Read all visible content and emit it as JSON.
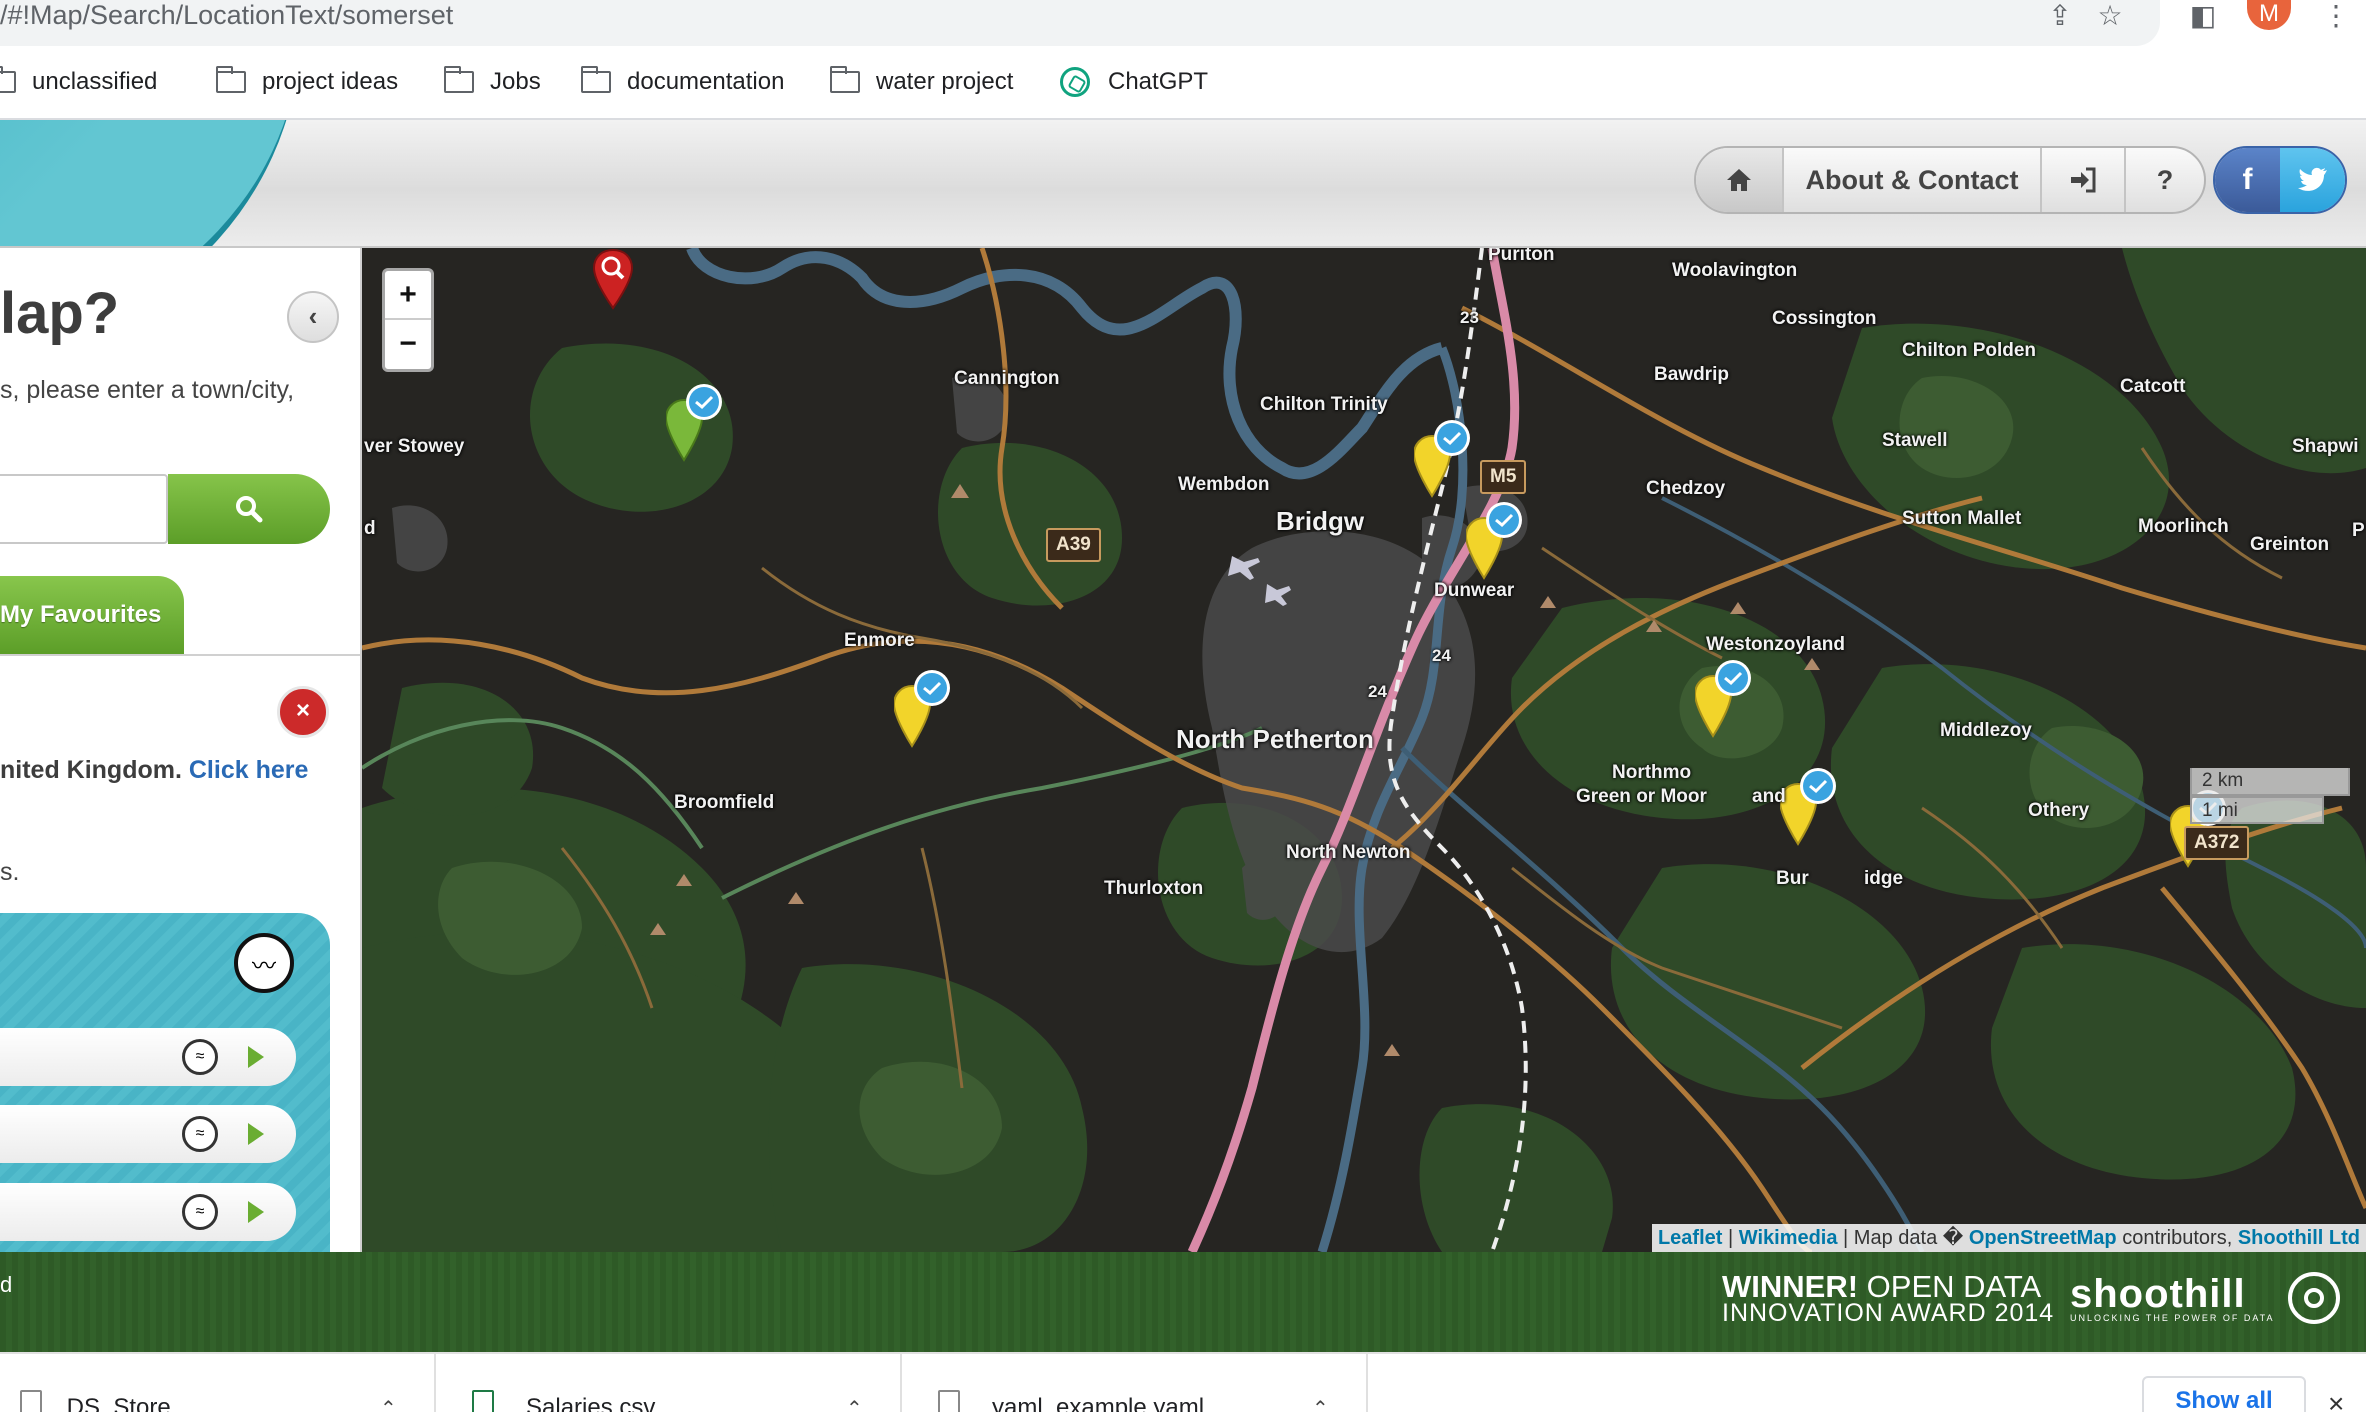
{
  "browser": {
    "url": "/#!Map/Search/LocationText/somerset",
    "profile_initial": "M",
    "bookmarks": [
      "unclassified",
      "project ideas",
      "Jobs",
      "documentation",
      "water project",
      "ChatGPT"
    ]
  },
  "header": {
    "nav_about": "About & Contact",
    "nav_help": "?",
    "social_facebook": "f"
  },
  "sidebar": {
    "title": "lap?",
    "prompt": "s, please enter a town/city,",
    "favourites_label": "My Favourites",
    "info_prefix": "nited Kingdom.",
    "info_link": "Click here",
    "info_tail": "s.",
    "close_symbol": "×"
  },
  "map": {
    "zoom_in": "+",
    "zoom_out": "−",
    "places": {
      "puriton": "Puriton",
      "woolavington": "Woolavington",
      "cossington": "Cossington",
      "chilton_polden": "Chilton Polden",
      "bawdrip": "Bawdrip",
      "catcott": "Catcott",
      "cannington": "Cannington",
      "chilton_trinity": "Chilton Trinity",
      "nether_stowey": "ver Stowey",
      "stawell": "Stawell",
      "shapwick": "Shapwi",
      "wembdon": "Wembdon",
      "chedzoy": "Chedzoy",
      "bridgwater": "Bridgw",
      "sutton_mallet": "Sutton Mallet",
      "moorlinch": "Moorlinch",
      "greinton": "Greinton",
      "dunwear": "Dunwear",
      "weston_zoyland": "Westonzoyland",
      "enmore": "Enmore",
      "middlezoy": "Middlezoy",
      "north_petherton": "North Petherton",
      "northmoor_1": "Northmo",
      "northmoor_2": "Green or Moor",
      "northmoor_3": "and",
      "othery": "Othery",
      "broomfield": "Broomfield",
      "north_newton": "North Newton",
      "thurloxton": "Thurloxton",
      "burrowbridge_1": "Bur",
      "burrowbridge_2": "idge",
      "left_d": "d",
      "right_p": "P"
    },
    "roads": {
      "a39": "A39",
      "m5": "M5",
      "a372": "A372",
      "j23": "23",
      "j24a": "24",
      "j24b": "24"
    },
    "scale_km": "2 km",
    "scale_mi": "1 mi",
    "attribution": {
      "leaflet": "Leaflet",
      "sep1": " | ",
      "wikimedia": "Wikimedia",
      "sep2": " | Map data � ",
      "osm": "OpenStreetMap",
      "contributors": " contributors, ",
      "shoothill": "Shoothill Ltd"
    },
    "colors": {
      "land_dark": "#262522",
      "field_green": "#2f4a28",
      "river": "#4a6b84",
      "road_orange": "#b07a3a",
      "motorway_pink": "#d98aa8"
    }
  },
  "footer": {
    "left_text": "d",
    "award_bold": "WINNER!",
    "award_rest": " OPEN DATA",
    "award_line2": "INNOVATION AWARD 2014",
    "logo_text": "shoothill",
    "logo_tag": "UNLOCKING THE POWER OF DATA"
  },
  "downloads": {
    "items": [
      ".DS_Store",
      "Salaries.csv",
      "yaml_example.yaml"
    ],
    "show_all": "Show all",
    "close": "×"
  }
}
